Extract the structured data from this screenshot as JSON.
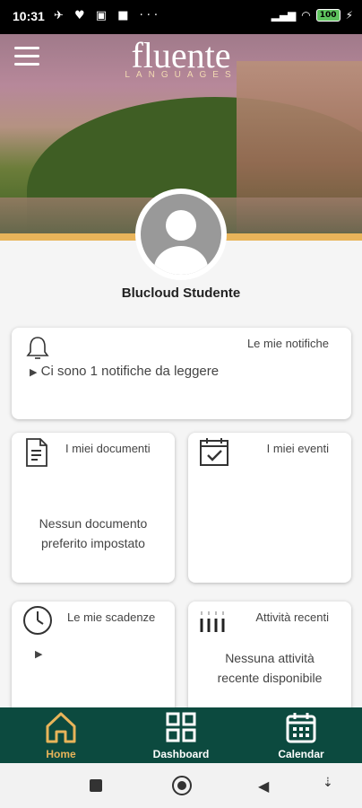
{
  "status_bar": {
    "time": "10:31",
    "battery": "100",
    "more": "···"
  },
  "header": {
    "brand": "fluente",
    "sub": "LANGUAGES"
  },
  "user": {
    "name": "Blucloud Studente"
  },
  "cards": {
    "notifications": {
      "title": "Le mie notifiche",
      "message": "Ci sono 1 notifiche da leggere"
    },
    "documents": {
      "title": "I miei documenti",
      "message_line1": "Nessun documento",
      "message_line2": "preferito impostato"
    },
    "events": {
      "title": "I miei eventi"
    },
    "deadlines": {
      "title": "Le mie scadenze"
    },
    "activities": {
      "title": "Attività recenti",
      "message_line1": "Nessuna attività",
      "message_line2": "recente disponibile"
    }
  },
  "bottom_nav": {
    "home": {
      "label": "Home",
      "icon": "home-icon"
    },
    "dashboard": {
      "label": "Dashboard",
      "icon": "grid-icon"
    },
    "calendar": {
      "label": "Calendar",
      "icon": "calendar-icon"
    }
  },
  "colors": {
    "nav_bg": "#0c4a3f",
    "nav_active": "#e8b45a",
    "accent_strip": "#e8b45a"
  }
}
